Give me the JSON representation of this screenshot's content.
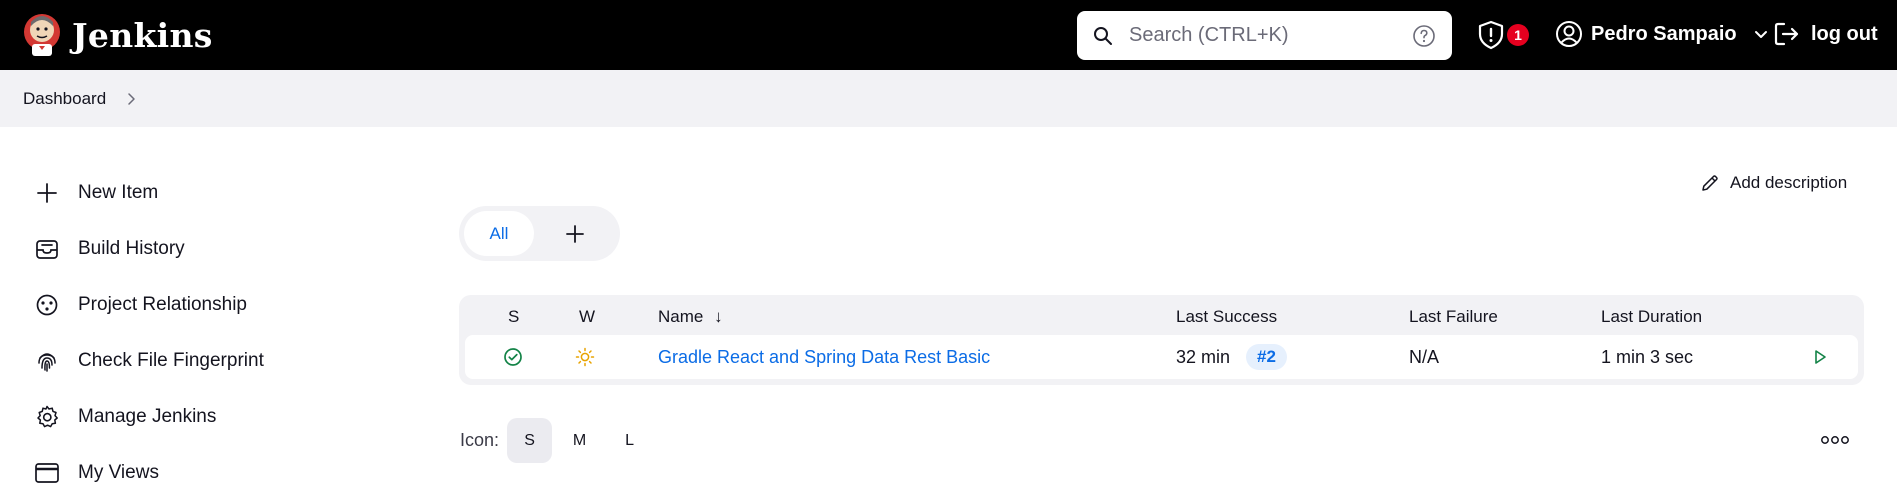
{
  "header": {
    "logo_text": "Jenkins",
    "search_placeholder": "Search (CTRL+K)",
    "security_count": "1",
    "user_name": "Pedro Sampaio",
    "logout_label": "log out",
    "background": "#000000"
  },
  "breadcrumb": {
    "items": [
      "Dashboard"
    ]
  },
  "sidebar": {
    "items": [
      {
        "label": "New Item",
        "icon": "plus-icon"
      },
      {
        "label": "Build History",
        "icon": "inbox-icon"
      },
      {
        "label": "Project Relationship",
        "icon": "relationship-icon"
      },
      {
        "label": "Check File Fingerprint",
        "icon": "fingerprint-icon"
      },
      {
        "label": "Manage Jenkins",
        "icon": "gear-icon"
      },
      {
        "label": "My Views",
        "icon": "window-icon"
      }
    ]
  },
  "main": {
    "add_description": "Add description",
    "tabs": {
      "active": "All"
    },
    "table": {
      "headers": {
        "status": "S",
        "weather": "W",
        "name": "Name",
        "name_sort": "↓",
        "last_success": "Last Success",
        "last_failure": "Last Failure",
        "last_duration": "Last Duration"
      },
      "rows": [
        {
          "status": "success",
          "weather": "sunny",
          "name": "Gradle React and Spring Data Rest Basic",
          "last_success": "32 min",
          "last_success_build": "#2",
          "last_failure": "N/A",
          "last_duration": "1 min 3 sec"
        }
      ]
    },
    "icon_size": {
      "label": "Icon:",
      "options": [
        "S",
        "M",
        "L"
      ],
      "selected": "S"
    }
  },
  "colors": {
    "accent": "#0b6ce6",
    "success": "#138347",
    "weather_sun": "#e8a300",
    "badge_red": "#e6001f"
  }
}
